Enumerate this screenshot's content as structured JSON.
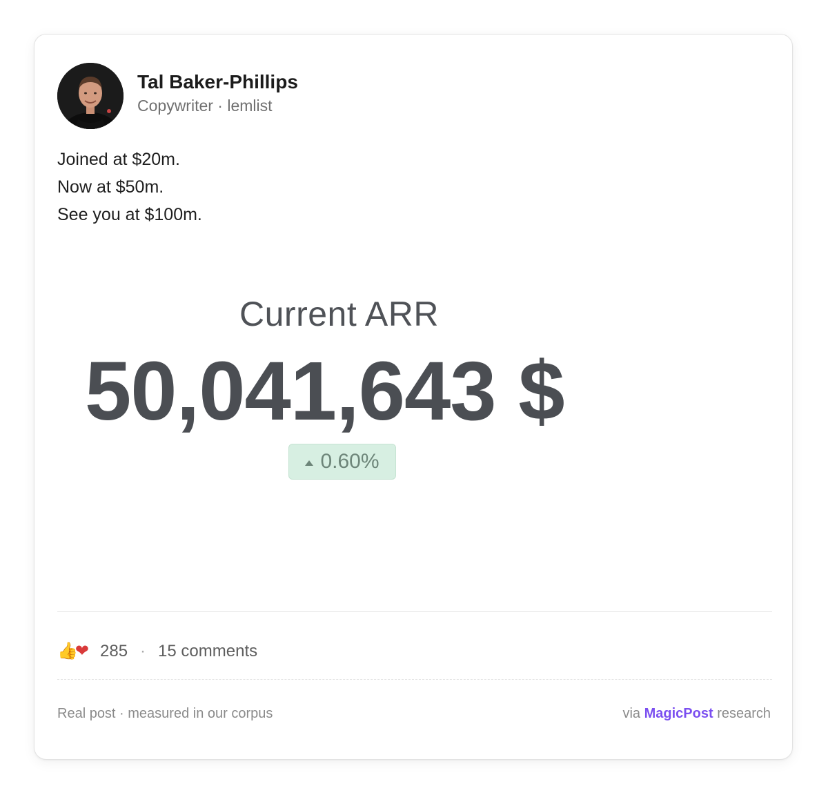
{
  "author": {
    "name": "Tal Baker-Phillips",
    "meta": "Copywriter · lemlist"
  },
  "post": {
    "lines": [
      "Joined at $20m.",
      "Now at $50m.",
      "See you at $100m."
    ]
  },
  "media": {
    "label": "Current ARR",
    "value": "50,041,643 $",
    "delta": "0.60%",
    "delta_color": "#d7efe2"
  },
  "engagement": {
    "reaction_icons": [
      "thumbs-up-icon",
      "heart-icon"
    ],
    "reactions_count": "285",
    "separator": "·",
    "comments": "15 comments"
  },
  "footer": {
    "left": "Real post · measured in our corpus",
    "via": "via",
    "brand": "MagicPost",
    "suffix": "research",
    "brand_color": "#7b4ff0"
  }
}
